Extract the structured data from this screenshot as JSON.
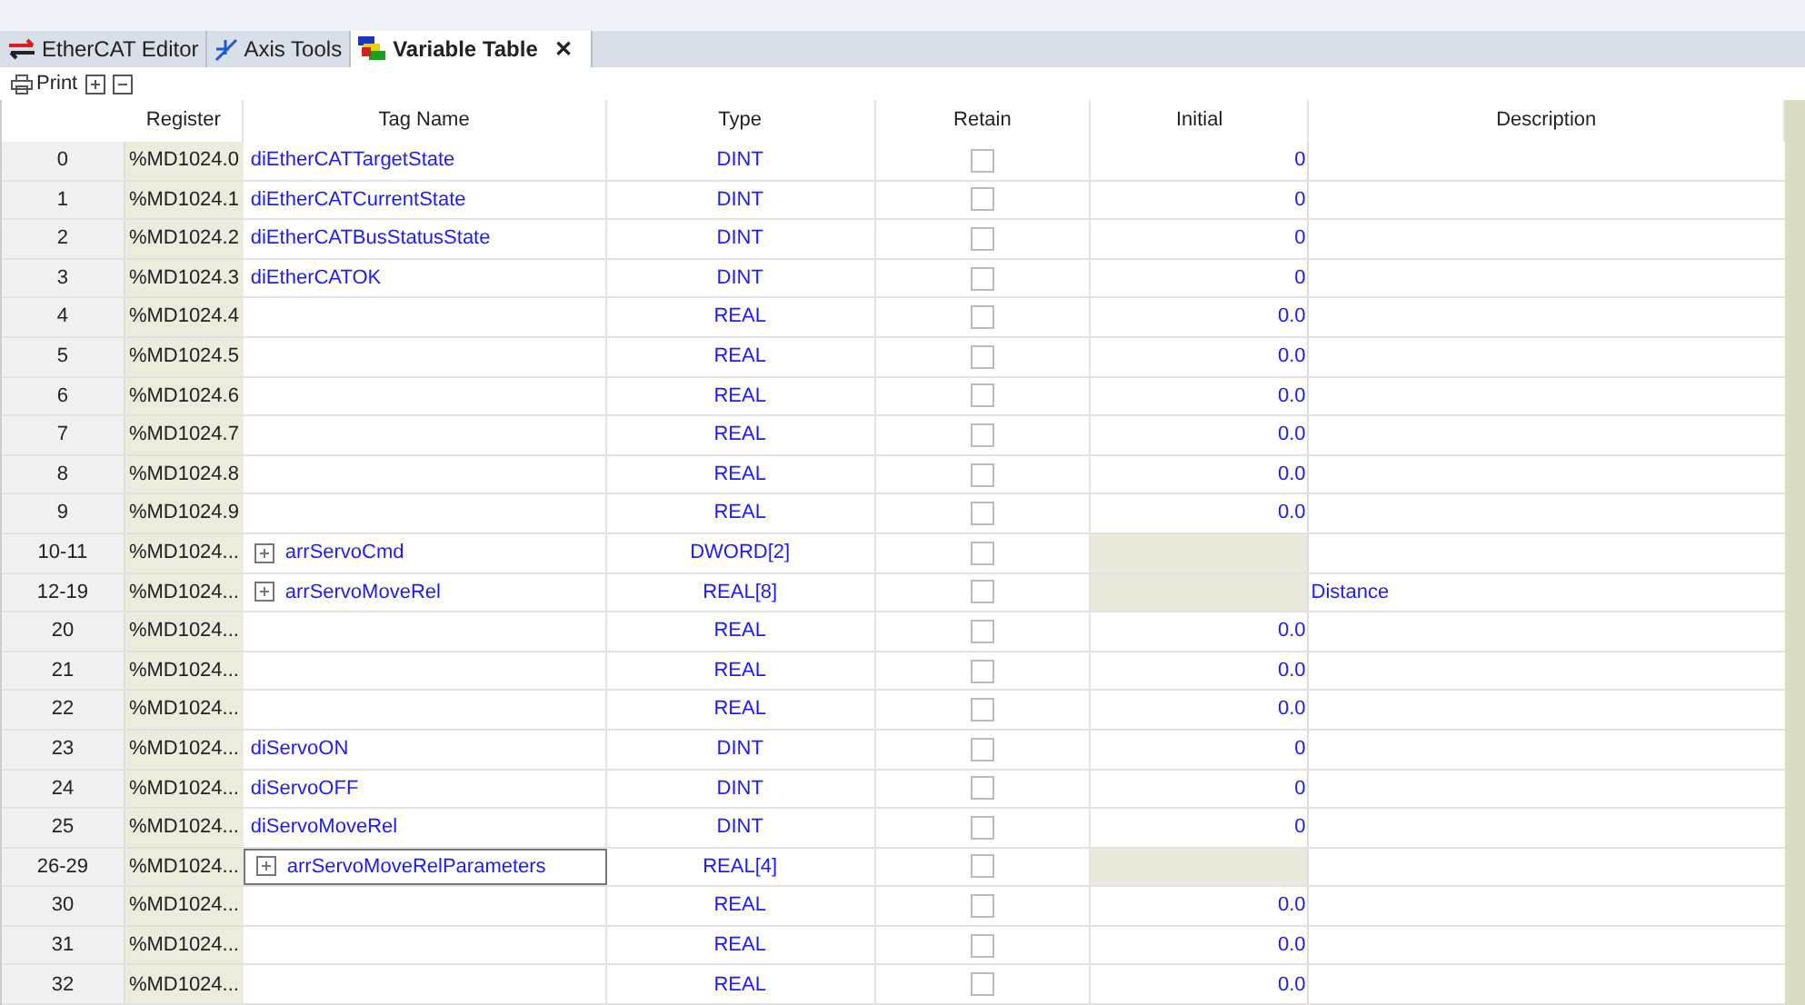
{
  "tabs": [
    {
      "label": "EtherCAT Editor",
      "selected": false
    },
    {
      "label": "Axis Tools",
      "selected": false
    },
    {
      "label": "Variable Table",
      "selected": true,
      "close": "✕"
    }
  ],
  "toolbar": {
    "print": "Print"
  },
  "table": {
    "columns": [
      "Register",
      "Tag Name",
      "Type",
      "Retain",
      "Initial",
      "Description"
    ],
    "rows": [
      {
        "index": "0",
        "register": "%MD1024.0",
        "tag": "diEtherCATTargetState",
        "type": "DINT",
        "retain": false,
        "initial": "0",
        "kind": "scalar",
        "selected": false
      },
      {
        "index": "1",
        "register": "%MD1024.1",
        "tag": "diEtherCATCurrentState",
        "type": "DINT",
        "retain": false,
        "initial": "0",
        "kind": "scalar",
        "selected": false
      },
      {
        "index": "2",
        "register": "%MD1024.2",
        "tag": "diEtherCATBusStatusState",
        "type": "DINT",
        "retain": false,
        "initial": "0",
        "kind": "scalar",
        "selected": false
      },
      {
        "index": "3",
        "register": "%MD1024.3",
        "tag": "diEtherCATOK",
        "type": "DINT",
        "retain": false,
        "initial": "0",
        "kind": "scalar",
        "selected": false
      },
      {
        "index": "4",
        "register": "%MD1024.4",
        "type": "REAL",
        "retain": false,
        "initial": "0.0",
        "kind": "scalar",
        "selected": false
      },
      {
        "index": "5",
        "register": "%MD1024.5",
        "type": "REAL",
        "retain": false,
        "initial": "0.0",
        "kind": "scalar",
        "selected": false
      },
      {
        "index": "6",
        "register": "%MD1024.6",
        "type": "REAL",
        "retain": false,
        "initial": "0.0",
        "kind": "scalar",
        "selected": false
      },
      {
        "index": "7",
        "register": "%MD1024.7",
        "type": "REAL",
        "retain": false,
        "initial": "0.0",
        "kind": "scalar",
        "selected": false
      },
      {
        "index": "8",
        "register": "%MD1024.8",
        "type": "REAL",
        "retain": false,
        "initial": "0.0",
        "kind": "scalar",
        "selected": false
      },
      {
        "index": "9",
        "register": "%MD1024.9",
        "type": "REAL",
        "retain": false,
        "initial": "0.0",
        "kind": "scalar",
        "selected": false
      },
      {
        "index": "10-11",
        "register": "%MD1024...",
        "tag": "arrServoCmd",
        "type": "DWORD[2]",
        "retain": false,
        "kind": "array",
        "expanded": false,
        "selected": false
      },
      {
        "index": "12-19",
        "register": "%MD1024...",
        "tag": "arrServoMoveRel",
        "type": "REAL[8]",
        "retain": false,
        "description": "Distance",
        "kind": "array",
        "expanded": false,
        "selected": false
      },
      {
        "index": "20",
        "register": "%MD1024...",
        "type": "REAL",
        "retain": false,
        "initial": "0.0",
        "kind": "scalar",
        "selected": false
      },
      {
        "index": "21",
        "register": "%MD1024...",
        "type": "REAL",
        "retain": false,
        "initial": "0.0",
        "kind": "scalar",
        "selected": false
      },
      {
        "index": "22",
        "register": "%MD1024...",
        "type": "REAL",
        "retain": false,
        "initial": "0.0",
        "kind": "scalar",
        "selected": false
      },
      {
        "index": "23",
        "register": "%MD1024...",
        "tag": "diServoON",
        "type": "DINT",
        "retain": false,
        "initial": "0",
        "kind": "scalar",
        "selected": false
      },
      {
        "index": "24",
        "register": "%MD1024...",
        "tag": "diServoOFF",
        "type": "DINT",
        "retain": false,
        "initial": "0",
        "kind": "scalar",
        "selected": false
      },
      {
        "index": "25",
        "register": "%MD1024...",
        "tag": "diServoMoveRel",
        "type": "DINT",
        "retain": false,
        "initial": "0",
        "kind": "scalar",
        "selected": false
      },
      {
        "index": "26-29",
        "register": "%MD1024...",
        "tag": "arrServoMoveRelParameters",
        "type": "REAL[4]",
        "retain": false,
        "kind": "array",
        "expanded": false,
        "selected": true
      },
      {
        "index": "30",
        "register": "%MD1024...",
        "type": "REAL",
        "retain": false,
        "initial": "0.0",
        "kind": "scalar",
        "selected": false
      },
      {
        "index": "31",
        "register": "%MD1024...",
        "type": "REAL",
        "retain": false,
        "initial": "0.0",
        "kind": "scalar",
        "selected": false
      },
      {
        "index": "32",
        "register": "%MD1024...",
        "type": "REAL",
        "retain": false,
        "initial": "0.0",
        "kind": "scalar",
        "selected": false
      }
    ]
  }
}
